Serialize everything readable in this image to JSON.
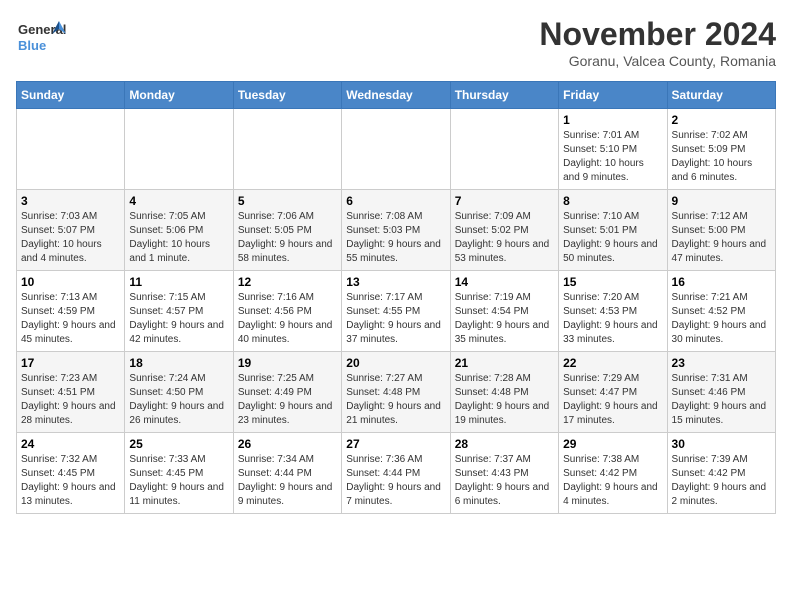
{
  "header": {
    "logo_line1": "General",
    "logo_line2": "Blue",
    "month": "November 2024",
    "location": "Goranu, Valcea County, Romania"
  },
  "weekdays": [
    "Sunday",
    "Monday",
    "Tuesday",
    "Wednesday",
    "Thursday",
    "Friday",
    "Saturday"
  ],
  "weeks": [
    [
      {
        "day": "",
        "info": ""
      },
      {
        "day": "",
        "info": ""
      },
      {
        "day": "",
        "info": ""
      },
      {
        "day": "",
        "info": ""
      },
      {
        "day": "",
        "info": ""
      },
      {
        "day": "1",
        "info": "Sunrise: 7:01 AM\nSunset: 5:10 PM\nDaylight: 10 hours and 9 minutes."
      },
      {
        "day": "2",
        "info": "Sunrise: 7:02 AM\nSunset: 5:09 PM\nDaylight: 10 hours and 6 minutes."
      }
    ],
    [
      {
        "day": "3",
        "info": "Sunrise: 7:03 AM\nSunset: 5:07 PM\nDaylight: 10 hours and 4 minutes."
      },
      {
        "day": "4",
        "info": "Sunrise: 7:05 AM\nSunset: 5:06 PM\nDaylight: 10 hours and 1 minute."
      },
      {
        "day": "5",
        "info": "Sunrise: 7:06 AM\nSunset: 5:05 PM\nDaylight: 9 hours and 58 minutes."
      },
      {
        "day": "6",
        "info": "Sunrise: 7:08 AM\nSunset: 5:03 PM\nDaylight: 9 hours and 55 minutes."
      },
      {
        "day": "7",
        "info": "Sunrise: 7:09 AM\nSunset: 5:02 PM\nDaylight: 9 hours and 53 minutes."
      },
      {
        "day": "8",
        "info": "Sunrise: 7:10 AM\nSunset: 5:01 PM\nDaylight: 9 hours and 50 minutes."
      },
      {
        "day": "9",
        "info": "Sunrise: 7:12 AM\nSunset: 5:00 PM\nDaylight: 9 hours and 47 minutes."
      }
    ],
    [
      {
        "day": "10",
        "info": "Sunrise: 7:13 AM\nSunset: 4:59 PM\nDaylight: 9 hours and 45 minutes."
      },
      {
        "day": "11",
        "info": "Sunrise: 7:15 AM\nSunset: 4:57 PM\nDaylight: 9 hours and 42 minutes."
      },
      {
        "day": "12",
        "info": "Sunrise: 7:16 AM\nSunset: 4:56 PM\nDaylight: 9 hours and 40 minutes."
      },
      {
        "day": "13",
        "info": "Sunrise: 7:17 AM\nSunset: 4:55 PM\nDaylight: 9 hours and 37 minutes."
      },
      {
        "day": "14",
        "info": "Sunrise: 7:19 AM\nSunset: 4:54 PM\nDaylight: 9 hours and 35 minutes."
      },
      {
        "day": "15",
        "info": "Sunrise: 7:20 AM\nSunset: 4:53 PM\nDaylight: 9 hours and 33 minutes."
      },
      {
        "day": "16",
        "info": "Sunrise: 7:21 AM\nSunset: 4:52 PM\nDaylight: 9 hours and 30 minutes."
      }
    ],
    [
      {
        "day": "17",
        "info": "Sunrise: 7:23 AM\nSunset: 4:51 PM\nDaylight: 9 hours and 28 minutes."
      },
      {
        "day": "18",
        "info": "Sunrise: 7:24 AM\nSunset: 4:50 PM\nDaylight: 9 hours and 26 minutes."
      },
      {
        "day": "19",
        "info": "Sunrise: 7:25 AM\nSunset: 4:49 PM\nDaylight: 9 hours and 23 minutes."
      },
      {
        "day": "20",
        "info": "Sunrise: 7:27 AM\nSunset: 4:48 PM\nDaylight: 9 hours and 21 minutes."
      },
      {
        "day": "21",
        "info": "Sunrise: 7:28 AM\nSunset: 4:48 PM\nDaylight: 9 hours and 19 minutes."
      },
      {
        "day": "22",
        "info": "Sunrise: 7:29 AM\nSunset: 4:47 PM\nDaylight: 9 hours and 17 minutes."
      },
      {
        "day": "23",
        "info": "Sunrise: 7:31 AM\nSunset: 4:46 PM\nDaylight: 9 hours and 15 minutes."
      }
    ],
    [
      {
        "day": "24",
        "info": "Sunrise: 7:32 AM\nSunset: 4:45 PM\nDaylight: 9 hours and 13 minutes."
      },
      {
        "day": "25",
        "info": "Sunrise: 7:33 AM\nSunset: 4:45 PM\nDaylight: 9 hours and 11 minutes."
      },
      {
        "day": "26",
        "info": "Sunrise: 7:34 AM\nSunset: 4:44 PM\nDaylight: 9 hours and 9 minutes."
      },
      {
        "day": "27",
        "info": "Sunrise: 7:36 AM\nSunset: 4:44 PM\nDaylight: 9 hours and 7 minutes."
      },
      {
        "day": "28",
        "info": "Sunrise: 7:37 AM\nSunset: 4:43 PM\nDaylight: 9 hours and 6 minutes."
      },
      {
        "day": "29",
        "info": "Sunrise: 7:38 AM\nSunset: 4:42 PM\nDaylight: 9 hours and 4 minutes."
      },
      {
        "day": "30",
        "info": "Sunrise: 7:39 AM\nSunset: 4:42 PM\nDaylight: 9 hours and 2 minutes."
      }
    ]
  ]
}
